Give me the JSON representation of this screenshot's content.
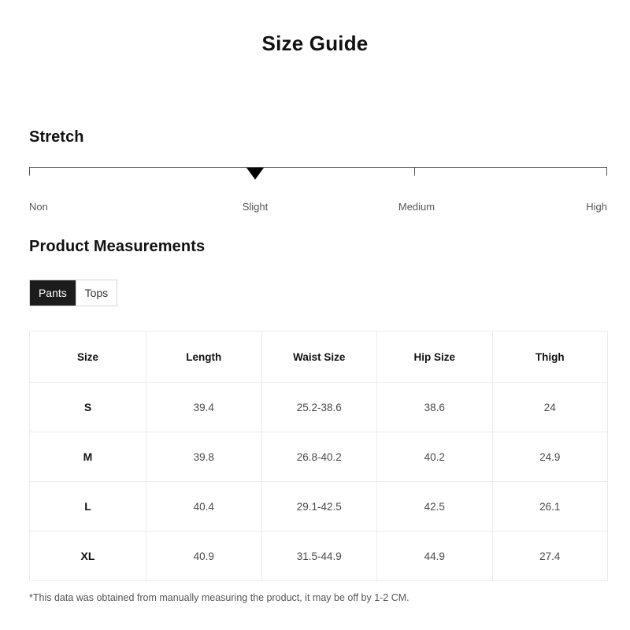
{
  "title": "Size Guide",
  "stretch": {
    "heading": "Stretch",
    "levels": [
      "Non",
      "Slight",
      "Medium",
      "High"
    ],
    "selected": "Slight",
    "marker_icon": "down-triangle-marker-icon"
  },
  "measurements": {
    "heading": "Product Measurements",
    "tabs": [
      {
        "label": "Pants",
        "active": true
      },
      {
        "label": "Tops",
        "active": false
      }
    ],
    "table": {
      "columns": [
        "Size",
        "Length",
        "Waist Size",
        "Hip Size",
        "Thigh"
      ],
      "rows": [
        {
          "size": "S",
          "length": "39.4",
          "waist": "25.2-38.6",
          "hip": "38.6",
          "thigh": "24"
        },
        {
          "size": "M",
          "length": "39.8",
          "waist": "26.8-40.2",
          "hip": "40.2",
          "thigh": "24.9"
        },
        {
          "size": "L",
          "length": "40.4",
          "waist": "29.1-42.5",
          "hip": "42.5",
          "thigh": "26.1"
        },
        {
          "size": "XL",
          "length": "40.9",
          "waist": "31.5-44.9",
          "hip": "44.9",
          "thigh": "27.4"
        }
      ]
    }
  },
  "footnote": "*This data was obtained from manually measuring the product, it may be off by 1-2 CM.",
  "colors": {
    "text": "#111111",
    "muted": "#555555",
    "accent": "#1c1c1c",
    "border": "#ececec"
  }
}
